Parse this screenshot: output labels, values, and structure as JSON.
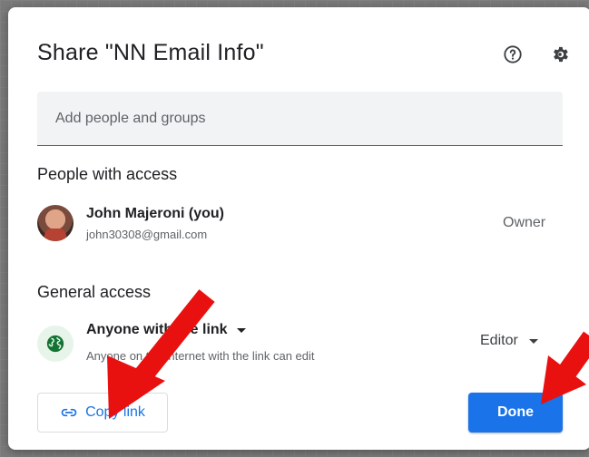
{
  "dialog": {
    "title": "Share \"NN Email Info\"",
    "help_icon": "help-circle-icon",
    "settings_icon": "gear-icon"
  },
  "add_people": {
    "placeholder": "Add people and groups",
    "value": ""
  },
  "people_section": {
    "title": "People with access",
    "people": [
      {
        "name": "John Majeroni (you)",
        "email": "john30308@gmail.com",
        "role": "Owner"
      }
    ]
  },
  "general_access": {
    "title": "General access",
    "icon": "globe-icon",
    "selected": "Anyone with the link",
    "description": "Anyone on the internet with the link can edit",
    "role": "Editor"
  },
  "buttons": {
    "copy_link": "Copy link",
    "copy_link_icon": "link-icon",
    "done": "Done"
  },
  "colors": {
    "accent": "#1a73e8",
    "annotation_arrow": "#e8110f",
    "globe_bg": "#e6f4ea",
    "globe_fg": "#137333"
  }
}
